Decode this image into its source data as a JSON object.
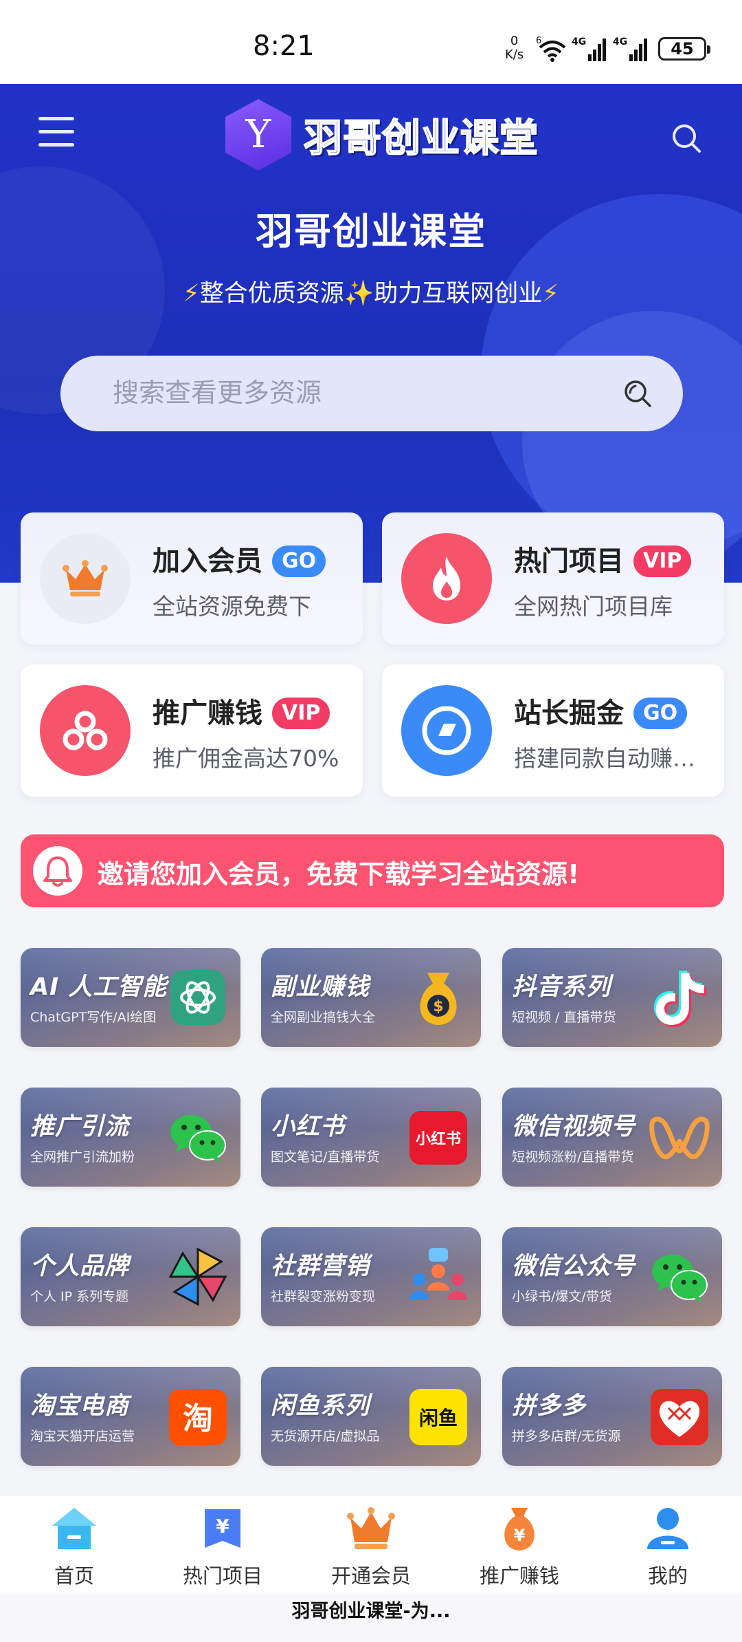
{
  "status": {
    "time": "8:21",
    "speed_value": "0",
    "speed_unit": "K/s",
    "wifi_label": "6",
    "net1": "4G",
    "net2": "4G",
    "battery": "45"
  },
  "header": {
    "logo_letter": "Y",
    "logo_text": "羽哥创业课堂",
    "title": "羽哥创业课堂",
    "subtitle": "整合优质资源✨助力互联网创业",
    "search_placeholder": "搜索查看更多资源"
  },
  "features": [
    {
      "title": "加入会员",
      "badge": "GO",
      "desc": "全站资源免费下",
      "icon": "crown-icon",
      "color": "#f07a2e"
    },
    {
      "title": "热门项目",
      "badge": "VIP",
      "desc": "全网热门项目库",
      "icon": "flame-icon",
      "color": "#f5546b"
    },
    {
      "title": "推广赚钱",
      "badge": "VIP",
      "desc": "推广佣金高达70%",
      "icon": "share-icon",
      "color": "#f5546b"
    },
    {
      "title": "站长掘金",
      "badge": "GO",
      "desc": "搭建同款自动赚钱网站",
      "icon": "compass-icon",
      "color": "#3a8af8"
    }
  ],
  "notice": {
    "text": "邀请您加入会员，免费下载学习全站资源!"
  },
  "categories": [
    {
      "title": "AI 人工智能",
      "sub": "ChatGPT写作/AI绘图",
      "icon": "chatgpt-icon"
    },
    {
      "title": "副业赚钱",
      "sub": "全网副业搞钱大全",
      "icon": "money-bag-icon"
    },
    {
      "title": "抖音系列",
      "sub": "短视频 / 直播带货",
      "icon": "tiktok-icon"
    },
    {
      "title": "推广引流",
      "sub": "全网推广引流加粉",
      "icon": "wechat-icon"
    },
    {
      "title": "小红书",
      "sub": "图文笔记/直播带货",
      "icon": "xiaohongshu-icon",
      "icon_text": "小红书"
    },
    {
      "title": "微信视频号",
      "sub": "短视频涨粉/直播带货",
      "icon": "channels-icon"
    },
    {
      "title": "个人品牌",
      "sub": "个人 IP 系列专题",
      "icon": "pinwheel-icon"
    },
    {
      "title": "社群营销",
      "sub": "社群裂变涨粉变现",
      "icon": "community-icon"
    },
    {
      "title": "微信公众号",
      "sub": "小绿书/爆文/带货",
      "icon": "wechat-icon"
    },
    {
      "title": "淘宝电商",
      "sub": "淘宝天猫开店运营",
      "icon": "taobao-icon",
      "icon_text": "淘"
    },
    {
      "title": "闲鱼系列",
      "sub": "无货源开店/虚拟品",
      "icon": "xianyu-icon",
      "icon_text": "闲鱼"
    },
    {
      "title": "拼多多",
      "sub": "拼多多店群/无货源",
      "icon": "pinduoduo-icon"
    }
  ],
  "tabbar": [
    {
      "label": "首页",
      "icon": "home-icon"
    },
    {
      "label": "热门项目",
      "icon": "yen-icon"
    },
    {
      "label": "开通会员",
      "icon": "crown-icon"
    },
    {
      "label": "推广赚钱",
      "icon": "money-bag-icon"
    },
    {
      "label": "我的",
      "icon": "user-icon"
    }
  ],
  "app_title": "羽哥创业课堂-为..."
}
